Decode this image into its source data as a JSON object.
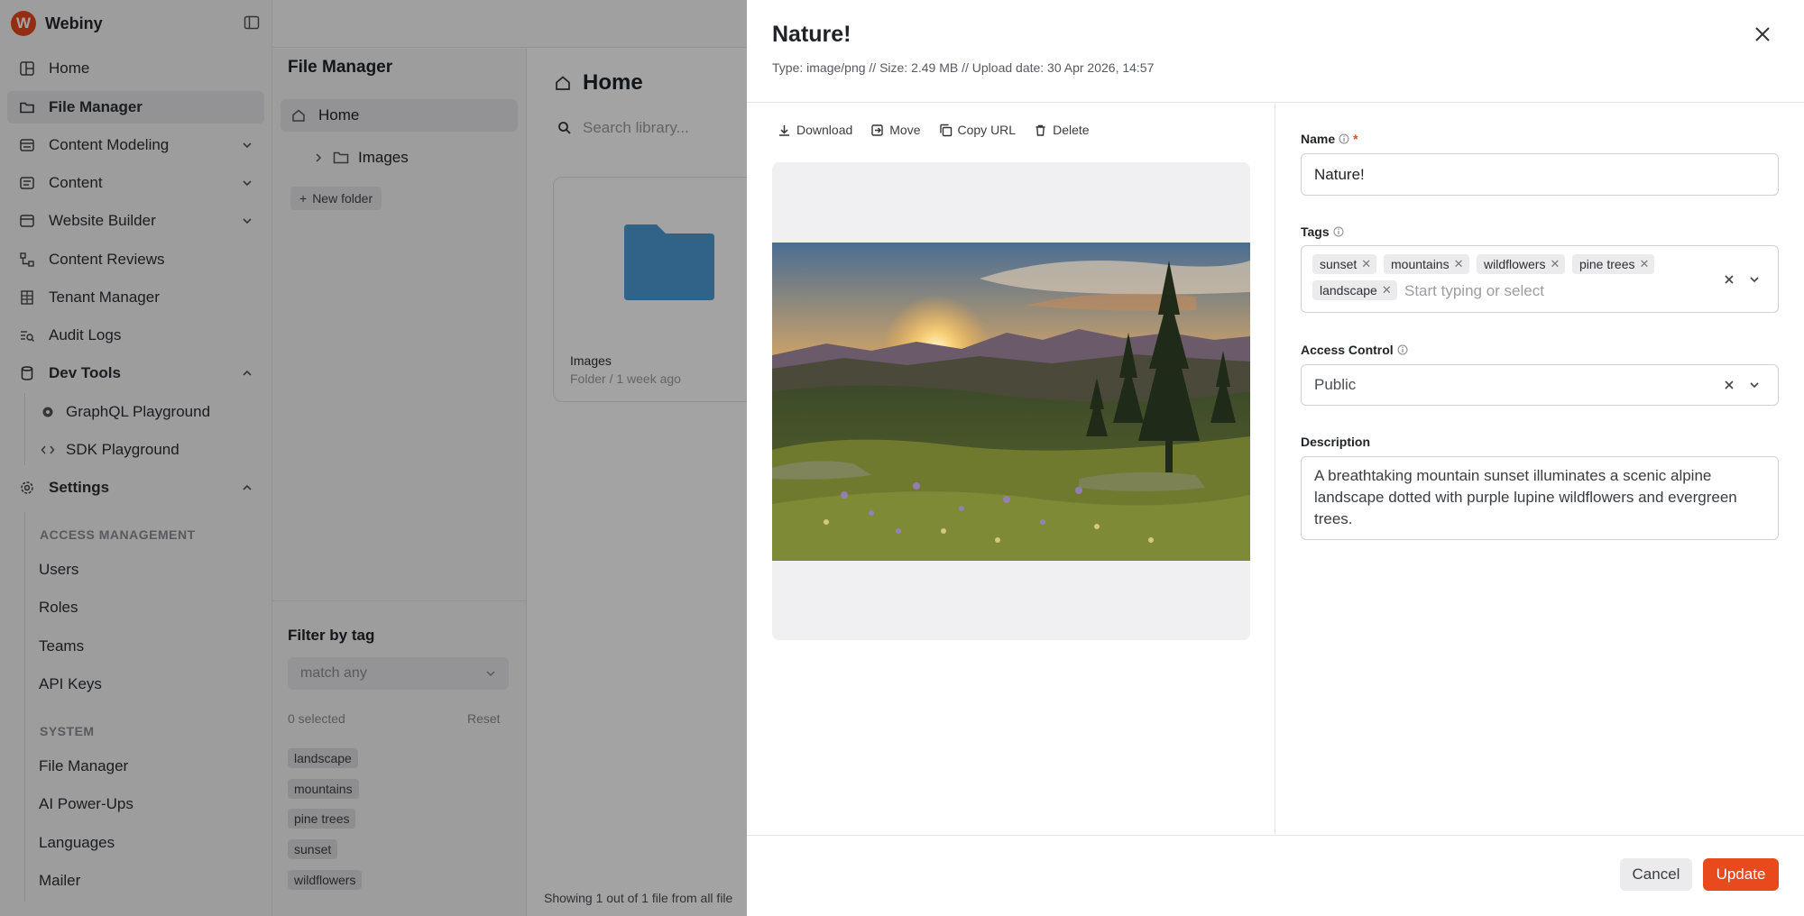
{
  "app": {
    "brand": "Webiny"
  },
  "sidebar": {
    "items": [
      {
        "label": "Home"
      },
      {
        "label": "File Manager"
      },
      {
        "label": "Content Modeling"
      },
      {
        "label": "Content"
      },
      {
        "label": "Website Builder"
      },
      {
        "label": "Content Reviews"
      },
      {
        "label": "Tenant Manager"
      },
      {
        "label": "Audit Logs"
      },
      {
        "label": "Dev Tools"
      }
    ],
    "dev_tools": [
      {
        "label": "GraphQL Playground"
      },
      {
        "label": "SDK Playground"
      }
    ],
    "settings_label": "Settings",
    "access_section": "ACCESS MANAGEMENT",
    "access_items": [
      {
        "label": "Users"
      },
      {
        "label": "Roles"
      },
      {
        "label": "Teams"
      },
      {
        "label": "API Keys"
      }
    ],
    "system_section": "SYSTEM",
    "system_items": [
      {
        "label": "File Manager"
      },
      {
        "label": "AI Power-Ups"
      },
      {
        "label": "Languages"
      },
      {
        "label": "Mailer"
      }
    ]
  },
  "fm_panel": {
    "title": "File Manager",
    "tree_home": "Home",
    "tree_images": "Images",
    "new_folder": "New folder",
    "filter_title": "Filter by tag",
    "match_placeholder": "match any",
    "selected_count": "0 selected",
    "reset": "Reset",
    "tags": [
      "landscape",
      "mountains",
      "pine trees",
      "sunset",
      "wildflowers"
    ]
  },
  "main": {
    "title": "Home",
    "search_placeholder": "Search library...",
    "folder": {
      "name": "Images",
      "meta": "Folder / 1 week ago"
    },
    "footer": "Showing 1 out of 1 file from all file"
  },
  "drawer": {
    "title": "Nature!",
    "meta": "Type: image/png // Size: 2.49 MB // Upload date: 30 Apr 2026, 14:57",
    "actions": {
      "download": "Download",
      "move": "Move",
      "copy_url": "Copy URL",
      "delete": "Delete"
    },
    "form": {
      "name_label": "Name",
      "required_mark": "*",
      "name_value": "Nature!",
      "tags_label": "Tags",
      "tags": [
        "sunset",
        "mountains",
        "wildflowers",
        "pine trees",
        "landscape"
      ],
      "tags_placeholder": "Start typing or select",
      "access_label": "Access Control",
      "access_value": "Public",
      "description_label": "Description",
      "description_value": "A breathtaking mountain sunset illuminates a scenic alpine landscape dotted with purple lupine wildflowers and evergreen trees."
    },
    "buttons": {
      "cancel": "Cancel",
      "update": "Update"
    }
  },
  "colors": {
    "brand": "#e8491d",
    "folder": "#4d9bd6"
  }
}
